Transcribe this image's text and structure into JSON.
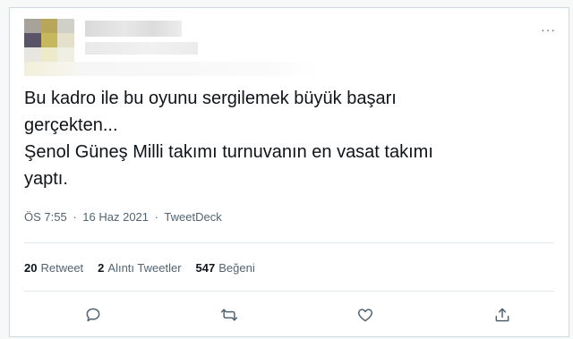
{
  "tweet": {
    "more_label": "···",
    "text": "Bu kadro ile bu oyunu sergilemek büyük başarı\ngerçekten...\nŞenol Güneş Milli takımı turnuvanın en vasat takımı\nyaptı.",
    "time": "ÖS 7:55",
    "separator": "·",
    "date": "16 Haz 2021",
    "source": "TweetDeck"
  },
  "stats": {
    "retweets_count": "20",
    "retweets_label": "Retweet",
    "quotes_count": "2",
    "quotes_label": "Alıntı Tweetler",
    "likes_count": "547",
    "likes_label": "Beğeni"
  },
  "actions": {
    "icons": [
      "reply-icon",
      "retweet-icon",
      "like-icon",
      "share-icon"
    ]
  },
  "colors": {
    "text": "#0f1419",
    "muted": "#536471",
    "border": "#cfd9de",
    "avatar_tiles": [
      "#a7a39b",
      "#b8a65a",
      "#d0d0c8",
      "#5a5468",
      "#c6b85c",
      "#e4e0cc",
      "#e8e6e0",
      "#eceac8",
      "#f0efe4"
    ]
  }
}
